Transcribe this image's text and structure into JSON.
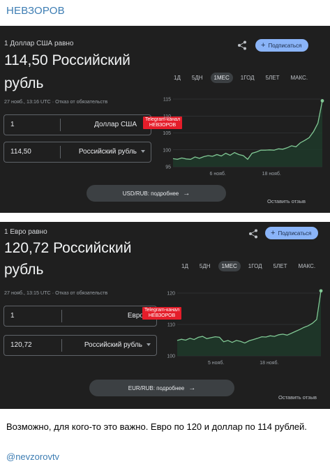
{
  "channel_name": "НЕВЗОРОВ",
  "cards": [
    {
      "equals": "1 Доллар США равно",
      "value_line1": "114,50 Российский",
      "value_line2": "рубль",
      "meta": "27 нояб., 13:16 UTC · Отказ от обязательств",
      "subscribe": "Подписаться",
      "ranges": [
        "1Д",
        "5ДН",
        "1МЕС",
        "1ГОД",
        "5ЛЕТ",
        "МАКС."
      ],
      "active_range": "1МЕС",
      "input1": {
        "value": "1",
        "currency": "Доллар США"
      },
      "input2": {
        "value": "114,50",
        "currency": "Российский рубль"
      },
      "badge": {
        "line1": "Telegram-канал",
        "line2": "НЕВЗОРОВ"
      },
      "more": "USD/RUB: подробнее",
      "feedback": "Оставить отзыв",
      "chart_data": {
        "type": "area",
        "x_ticks": [
          "6 нояб.",
          "18 нояб."
        ],
        "y_ticks": [
          "95",
          "100",
          "105",
          "110",
          "115"
        ],
        "ylim": [
          95,
          115
        ],
        "values": [
          97.4,
          97.2,
          97.6,
          97.3,
          97.2,
          97.9,
          97.5,
          98.0,
          98.3,
          98.1,
          98.6,
          98.2,
          99.0,
          98.4,
          99.2,
          98.6,
          98.3,
          97.2,
          99.0,
          99.4,
          99.9,
          99.9,
          100.0,
          99.9,
          100.3,
          100.2,
          100.6,
          101.2,
          100.9,
          102.1,
          102.8,
          103.6,
          105.4,
          107.9,
          114.5
        ],
        "color": "#81c995"
      }
    },
    {
      "equals": "1 Евро равно",
      "value_line1": "120,72 Российский",
      "value_line2": "рубль",
      "meta": "27 нояб., 13:15 UTC · Отказ от обязательств",
      "subscribe": "Подписаться",
      "ranges": [
        "1Д",
        "5ДН",
        "1МЕС",
        "1ГОД",
        "5ЛЕТ",
        "МАКС."
      ],
      "active_range": "1МЕС",
      "input1": {
        "value": "1",
        "currency": "Евро"
      },
      "input2": {
        "value": "120,72",
        "currency": "Российский рубль"
      },
      "badge": {
        "line1": "Telegram-канал",
        "line2": "НЕВЗОРОВ"
      },
      "more": "EUR/RUB: подробнее",
      "feedback": "Оставить отзыв",
      "chart_data": {
        "type": "area",
        "x_ticks": [
          "5 нояб.",
          "18 нояб."
        ],
        "y_ticks": [
          "100",
          "110",
          "120"
        ],
        "ylim": [
          100,
          120
        ],
        "values": [
          104.9,
          105.3,
          105.0,
          105.6,
          105.2,
          105.9,
          106.2,
          105.5,
          105.8,
          106.1,
          105.9,
          104.5,
          104.9,
          104.3,
          104.9,
          104.6,
          104.1,
          104.8,
          105.2,
          105.6,
          106.1,
          106.0,
          106.4,
          106.2,
          106.7,
          106.9,
          106.6,
          107.2,
          107.8,
          108.4,
          109.1,
          109.6,
          110.4,
          111.6,
          120.7
        ],
        "color": "#81c995"
      }
    }
  ],
  "post_text": "Возможно, для кого-то это важно. Евро по 120 и доллар по 114 рублей.",
  "handle": "@nevzorovtv"
}
